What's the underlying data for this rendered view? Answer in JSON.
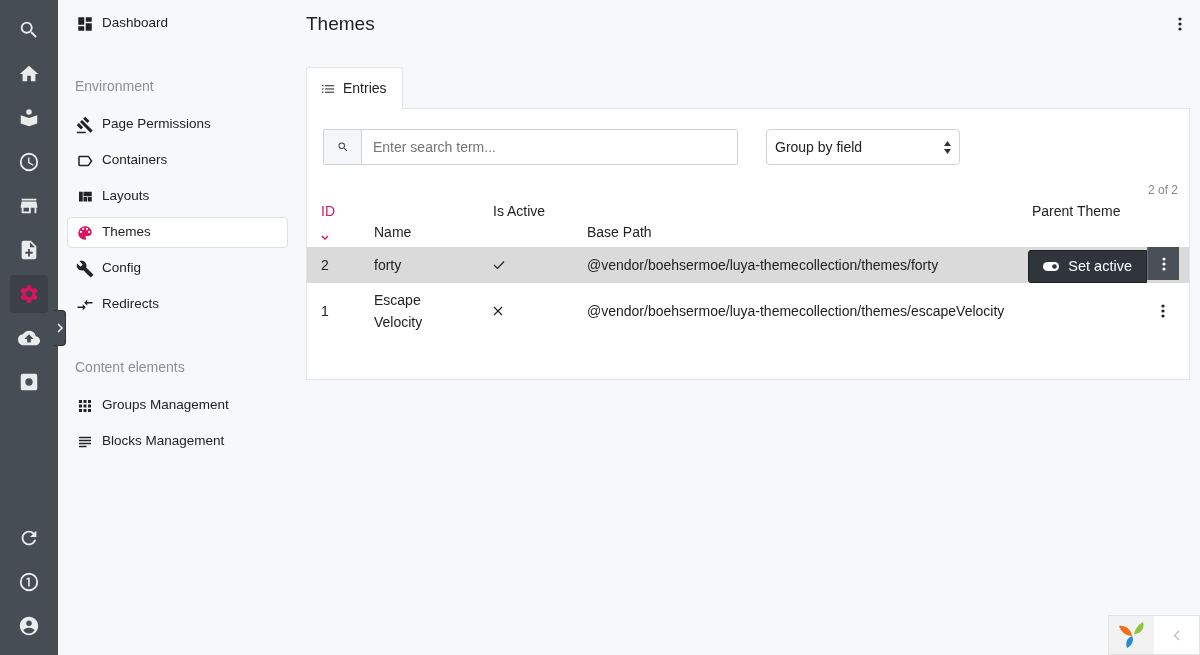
{
  "rail": {
    "top": [
      {
        "selected": false
      },
      {
        "selected": false
      },
      {
        "selected": false
      },
      {
        "selected": false
      },
      {
        "selected": false
      },
      {
        "selected": false
      },
      {
        "selected": true
      },
      {
        "selected": false
      },
      {
        "selected": false
      }
    ],
    "bottom": [
      {
        "selected": false
      },
      {
        "selected": false
      },
      {
        "selected": false
      }
    ]
  },
  "sidebar": {
    "groups": [
      {
        "items": [
          {
            "label": "Dashboard",
            "selected": false
          }
        ]
      },
      {
        "heading": "Environment",
        "items": [
          {
            "label": "Page Permissions",
            "selected": false
          },
          {
            "label": "Containers",
            "selected": false
          },
          {
            "label": "Layouts",
            "selected": false
          },
          {
            "label": "Themes",
            "selected": true
          },
          {
            "label": "Config",
            "selected": false
          },
          {
            "label": "Redirects",
            "selected": false
          }
        ]
      },
      {
        "heading": "Content elements",
        "items": [
          {
            "label": "Groups Management",
            "selected": false
          },
          {
            "label": "Blocks Management",
            "selected": false
          }
        ]
      }
    ]
  },
  "page": {
    "title": "Themes"
  },
  "tabs": [
    {
      "label": "Entries",
      "selected": true
    }
  ],
  "search": {
    "placeholder": "Enter search term..."
  },
  "group_select": {
    "value": "Group by field"
  },
  "count": "2 of 2",
  "table": {
    "columns": [
      {
        "label": "ID",
        "sorted": true
      },
      {
        "label": "Name",
        "sorted": false
      },
      {
        "label": "Is Active",
        "sorted": false
      },
      {
        "label": "Base Path",
        "sorted": false
      },
      {
        "label": "Parent Theme",
        "sorted": false
      }
    ],
    "rows": [
      {
        "id": "2",
        "name": "forty",
        "active": true,
        "base_path": "@vendor/boehsermoe/luya-themecollection/themes/forty",
        "selected": true,
        "action": "Set active"
      },
      {
        "id": "1",
        "name": "Escape Velocity",
        "active": false,
        "base_path": "@vendor/boehsermoe/luya-themecollection/themes/escapeVelocity",
        "selected": false
      }
    ]
  }
}
